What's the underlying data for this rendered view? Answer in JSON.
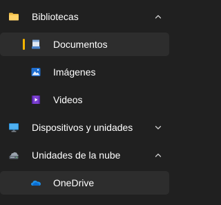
{
  "tree": {
    "bibliotecas": {
      "label": "Bibliotecas",
      "icon": "folder-icon"
    },
    "documentos": {
      "label": "Documentos",
      "icon": "documents-icon"
    },
    "imagenes": {
      "label": "Imágenes",
      "icon": "pictures-icon"
    },
    "videos": {
      "label": "Videos",
      "icon": "videos-icon"
    },
    "dispositivos": {
      "label": "Dispositivos y unidades",
      "icon": "monitor-icon"
    },
    "nube": {
      "label": "Unidades de la nube",
      "icon": "cloud-drive-icon"
    },
    "onedrive": {
      "label": "OneDrive",
      "icon": "onedrive-cloud-icon"
    }
  },
  "colors": {
    "background": "#202020",
    "selected_background": "#2d2d2d",
    "accent": "#f7b500"
  }
}
